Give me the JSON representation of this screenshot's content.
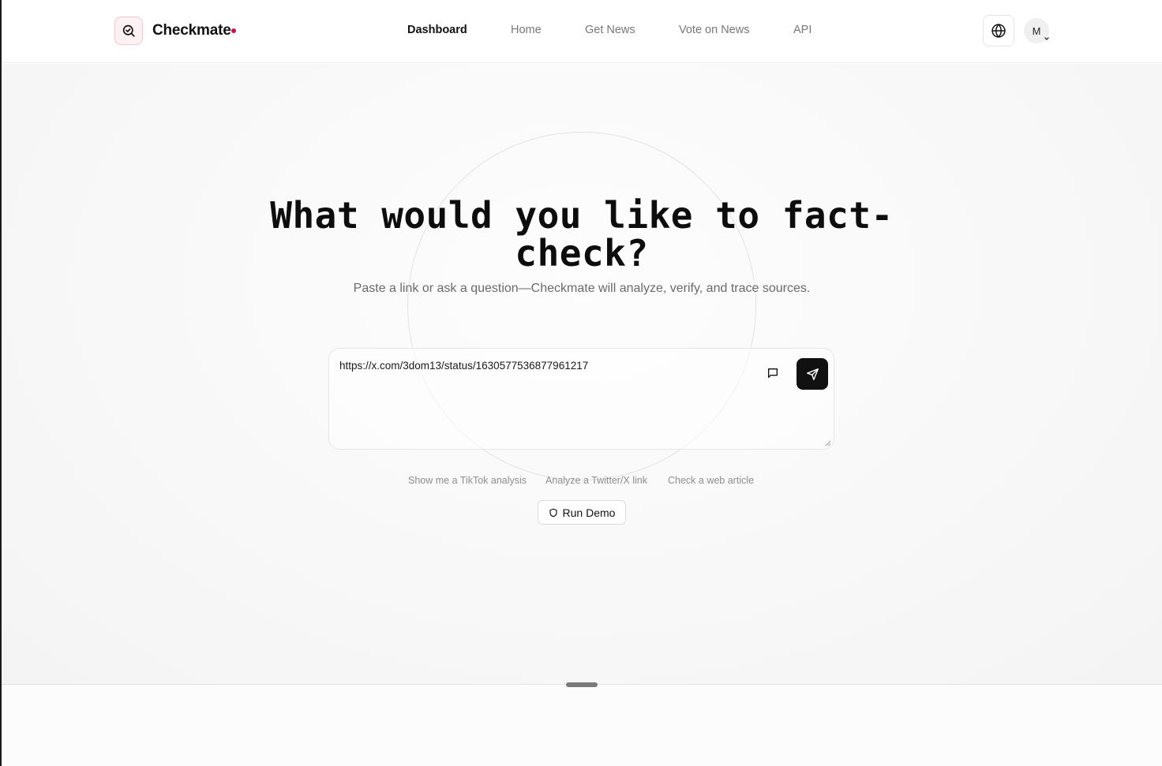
{
  "header": {
    "brand": "Checkmate",
    "nav": [
      {
        "label": "Dashboard",
        "active": true
      },
      {
        "label": "Home",
        "active": false
      },
      {
        "label": "Get News",
        "active": false
      },
      {
        "label": "Vote on News",
        "active": false
      },
      {
        "label": "API",
        "active": false
      }
    ],
    "avatar_initial": "M",
    "icons": {
      "logo": "search-check-icon",
      "language": "globe-icon",
      "avatar_menu": "chevron-down-icon"
    }
  },
  "hero": {
    "title": "What would you like to fact-check?",
    "subtitle": "Paste a link or ask a question—Checkmate will analyze, verify, and trace sources."
  },
  "input": {
    "value": "https://x.com/3dom13/status/1630577536877961217",
    "icons": {
      "chat": "message-square-icon",
      "send": "send-icon"
    }
  },
  "suggestions": [
    "Show me a TikTok analysis",
    "Analyze a Twitter/X link",
    "Check a web article"
  ],
  "demo": {
    "label": "Run Demo",
    "icon": "shield-icon"
  },
  "colors": {
    "accent": "#c8134a",
    "primary_button": "#111111",
    "logo_bg": "#fdf1f4"
  }
}
